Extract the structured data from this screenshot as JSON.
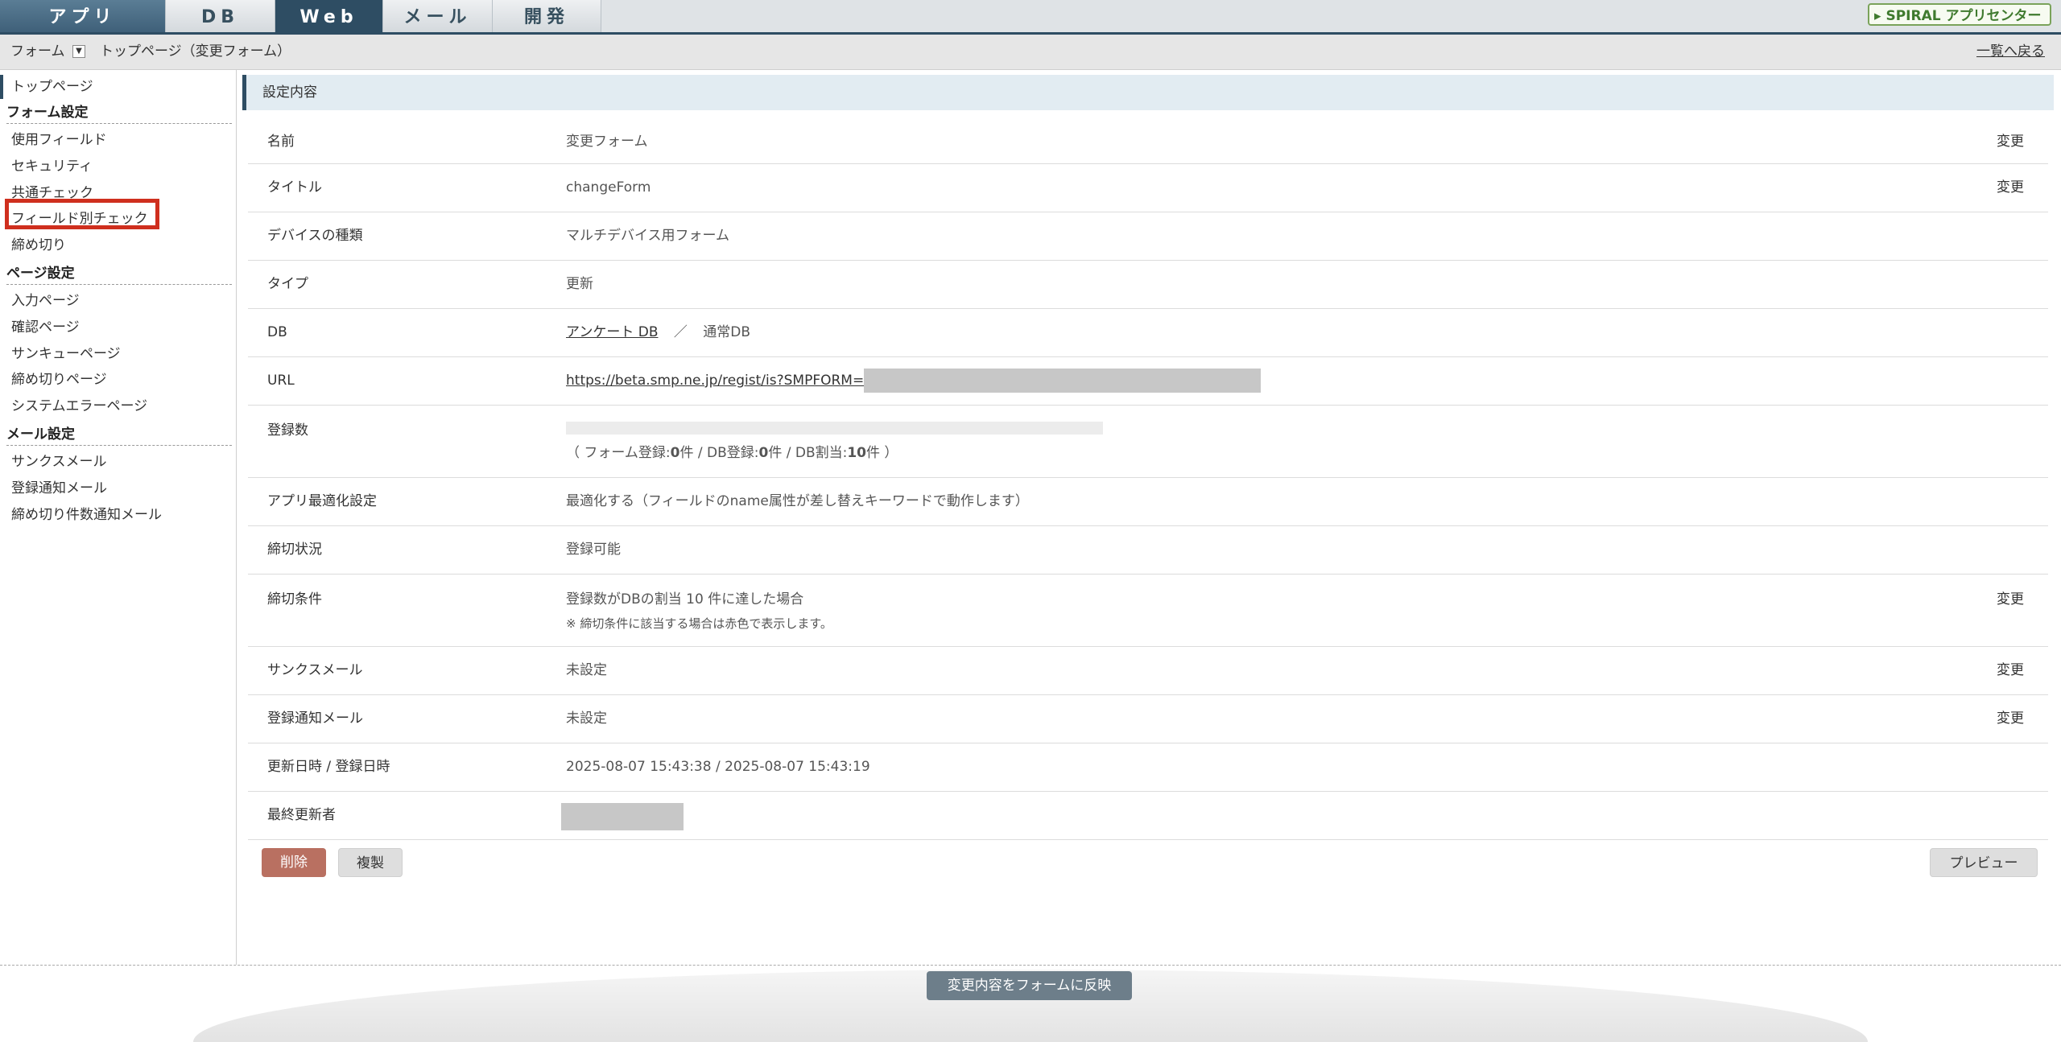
{
  "topnav": {
    "tabs": [
      {
        "label": "アプリ"
      },
      {
        "label": "DB"
      },
      {
        "label": "Web"
      },
      {
        "label": "メール"
      },
      {
        "label": "開発"
      }
    ],
    "spiral_button": "SPIRAL アプリセンター"
  },
  "breadcrumb": {
    "form_label": "フォーム",
    "page_label": "トップページ（変更フォーム）",
    "back_link": "一覧へ戻る"
  },
  "sidebar": {
    "top_page": "トップページ",
    "form_settings": {
      "heading": "フォーム設定",
      "items": [
        "使用フィールド",
        "セキュリティ",
        "共通チェック",
        "フィールド別チェック",
        "締め切り"
      ]
    },
    "page_settings": {
      "heading": "ページ設定",
      "items": [
        "入力ページ",
        "確認ページ",
        "サンキューページ",
        "締め切りページ",
        "システムエラーページ"
      ]
    },
    "mail_settings": {
      "heading": "メール設定",
      "items": [
        "サンクスメール",
        "登録通知メール",
        "締め切り件数通知メール"
      ]
    }
  },
  "main": {
    "section_title": "設定内容",
    "change_label": "変更",
    "rows": {
      "name": {
        "label": "名前",
        "value": "変更フォーム"
      },
      "title": {
        "label": "タイトル",
        "value": "changeForm"
      },
      "device": {
        "label": "デバイスの種類",
        "value": "マルチデバイス用フォーム"
      },
      "type": {
        "label": "タイプ",
        "value": "更新"
      },
      "db": {
        "label": "DB",
        "link": "アンケート DB",
        "sep": "／",
        "value": "通常DB"
      },
      "url": {
        "label": "URL",
        "link": "https://beta.smp.ne.jp/regist/is?SMPFORM="
      },
      "count": {
        "label": "登録数",
        "open": "（ フォーム登録:",
        "form_count": "0",
        "mid1": "件 / DB登録:",
        "db_count": "0",
        "mid2": "件 / DB割当:",
        "alloc": "10",
        "close": "件 ）",
        "fill": 0
      },
      "optimize": {
        "label": "アプリ最適化設定",
        "value": "最適化する（フィールドのname属性が差し替えキーワードで動作します）"
      },
      "deadline_status": {
        "label": "締切状況",
        "value": "登録可能"
      },
      "deadline_cond": {
        "label": "締切条件",
        "value": "登録数がDBの割当 10 件に達した場合",
        "note": "※ 締切条件に該当する場合は赤色で表示します。"
      },
      "thanks_mail": {
        "label": "サンクスメール",
        "value": "未設定"
      },
      "notify_mail": {
        "label": "登録通知メール",
        "value": "未設定"
      },
      "dates": {
        "label": "更新日時 / 登録日時",
        "value": "2025-08-07 15:43:38 / 2025-08-07 15:43:19"
      },
      "last_editor": {
        "label": "最終更新者"
      }
    },
    "buttons": {
      "delete": "削除",
      "copy": "複製",
      "preview": "プレビュー"
    }
  },
  "footer": {
    "apply_button": "変更内容をフォームに反映"
  },
  "colors": {
    "accent": "#2e4d63",
    "highlight": "#cf2f1e",
    "delete": "#b97061"
  }
}
